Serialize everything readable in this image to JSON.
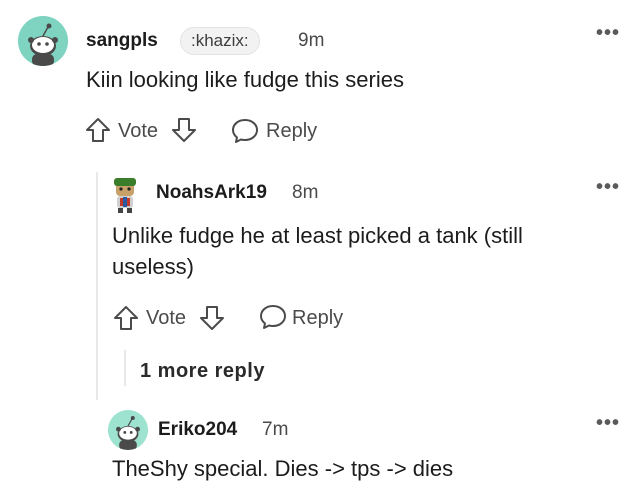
{
  "comments": [
    {
      "username": "sangpls",
      "flair": ":khazix:",
      "time": "9m",
      "body": "Kiin looking like fudge this series",
      "vote_label": "Vote",
      "reply_label": "Reply",
      "avatar_icon": "snoo-avatar-icon"
    },
    {
      "username": "NoahsArk19",
      "time": "8m",
      "body_line1": "Unlike fudge he at least picked a tank (still",
      "body_line2": "useless)",
      "vote_label": "Vote",
      "reply_label": "Reply",
      "avatar_icon": "custom-avatar-icon"
    },
    {
      "username": "Eriko204",
      "time": "7m",
      "body": "TheShy special. Dies -> tps -> dies",
      "avatar_icon": "snoo-avatar-icon"
    }
  ],
  "more_replies_label": "1 more reply",
  "more_options_glyph": "•••",
  "colors": {
    "avatar_teal": "#7fd4c1",
    "text_primary": "#1c1c1c",
    "text_secondary": "#4b4b4b",
    "thread_line": "#e8e8e8"
  }
}
